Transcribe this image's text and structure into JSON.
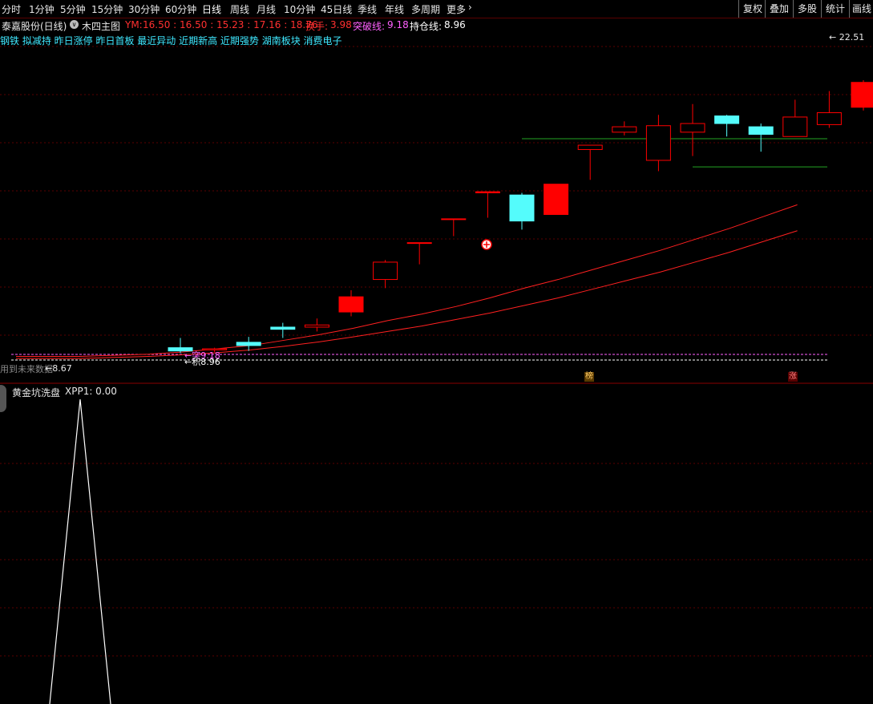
{
  "toolbar": {
    "periods": [
      "分时",
      "1分钟",
      "5分钟",
      "15分钟",
      "30分钟",
      "60分钟",
      "日线",
      "周线",
      "月线",
      "10分钟",
      "45日线",
      "季线",
      "年线",
      "多周期",
      "更多"
    ],
    "active_period": "日线",
    "more_icon": "chevron-right-icon",
    "right_buttons": [
      "复权",
      "叠加",
      "多股",
      "统计",
      "画线"
    ]
  },
  "info": {
    "stock": "泰嘉股份(日线)",
    "dropdown_icon": "chevron-down-circle-icon",
    "indicator": "木四主图",
    "ym_label": "YM:",
    "ym_values": "16.50 : 16.50 : 15.23 : 17.16 : 18.76",
    "turnover_label": "换手:",
    "turnover_value": "3.98",
    "breakout_label": "突破线:",
    "breakout_value": "9.18",
    "holding_label": "持仓线:",
    "holding_value": "8.96"
  },
  "tags": "钢铁 拟减持 昨日涨停 昨日首板 最近异动 近期新高 近期强势 湖南板块 消费电子",
  "main_chart": {
    "price_top": "22.51",
    "breakout_line_label": "突9.18",
    "holding_line_label": "积8.96",
    "bottom_left_label": "用到未来数据",
    "low_label": "8.67",
    "marker_bang": "榜",
    "marker_zhang": "涨",
    "colors": {
      "up": "#ff0000",
      "down": "#54fcfc",
      "ma": "#ff2020",
      "guide": "#23a323"
    }
  },
  "sub_panel": {
    "title": "黄金坑洗盘",
    "value_label": "XPP1: 0.00",
    "icon": "gear-icon"
  },
  "chart_data": {
    "type": "candlestick",
    "candles": [
      {
        "open": 9.45,
        "close": 9.3,
        "high": 9.9,
        "low": 9.2
      },
      {
        "open": 9.35,
        "close": 9.4,
        "high": 9.45,
        "low": 9.25
      },
      {
        "open": 9.7,
        "close": 9.55,
        "high": 9.95,
        "low": 9.3
      },
      {
        "open": 10.4,
        "close": 10.3,
        "high": 10.6,
        "low": 9.9
      },
      {
        "open": 10.4,
        "close": 10.5,
        "high": 10.8,
        "low": 10.2
      },
      {
        "open": 11.1,
        "close": 11.8,
        "high": 12.1,
        "low": 10.9
      },
      {
        "open": 12.6,
        "close": 13.4,
        "high": 13.5,
        "low": 12.2
      },
      {
        "open": 14.3,
        "close": 14.3,
        "high": 14.3,
        "low": 13.3
      },
      {
        "open": 15.4,
        "close": 15.4,
        "high": 15.4,
        "low": 14.6
      },
      {
        "open": 16.6,
        "close": 16.65,
        "high": 16.65,
        "low": 15.45
      },
      {
        "open": 16.5,
        "close": 15.3,
        "high": 16.6,
        "low": 14.9
      },
      {
        "open": 15.6,
        "close": 17.0,
        "high": 17.0,
        "low": 15.6
      },
      {
        "open": 18.6,
        "close": 18.8,
        "high": 18.8,
        "low": 17.2
      },
      {
        "open": 19.4,
        "close": 19.65,
        "high": 19.9,
        "low": 19.25
      },
      {
        "open": 18.1,
        "close": 19.7,
        "high": 20.2,
        "low": 17.6
      },
      {
        "open": 19.4,
        "close": 19.8,
        "high": 20.7,
        "low": 18.3
      },
      {
        "open": 20.15,
        "close": 19.8,
        "high": 20.2,
        "low": 19.2
      },
      {
        "open": 19.65,
        "close": 19.3,
        "high": 19.8,
        "low": 18.5
      },
      {
        "open": 19.2,
        "close": 20.1,
        "high": 20.9,
        "low": 19.2
      },
      {
        "open": 19.75,
        "close": 20.3,
        "high": 21.3,
        "low": 19.6
      },
      {
        "open": 20.55,
        "close": 21.7,
        "high": 21.8,
        "low": 20.4
      },
      {
        "open": 22.0,
        "close": 23.4,
        "high": 23.4,
        "low": 22.0
      }
    ],
    "ma1": [
      9.05,
      9.1,
      9.15,
      9.25,
      9.4,
      9.55,
      9.8,
      10.05,
      10.35,
      10.7,
      11.0,
      11.35,
      11.75,
      12.2,
      12.6,
      13.05,
      13.5,
      13.95,
      14.45,
      14.95,
      15.5,
      16.05
    ],
    "ma2": [
      8.95,
      9.0,
      9.05,
      9.12,
      9.22,
      9.35,
      9.52,
      9.72,
      9.95,
      10.2,
      10.45,
      10.75,
      11.05,
      11.4,
      11.75,
      12.15,
      12.55,
      12.95,
      13.4,
      13.85,
      14.35,
      14.85
    ],
    "guide_lines": [
      {
        "value": 19.1
      },
      {
        "value": 17.8
      }
    ],
    "ylim": [
      8.4,
      23.8
    ],
    "sub_series": {
      "name": "XPP1",
      "peak_index": 2,
      "peak_value": 1,
      "base_value": 0
    }
  }
}
